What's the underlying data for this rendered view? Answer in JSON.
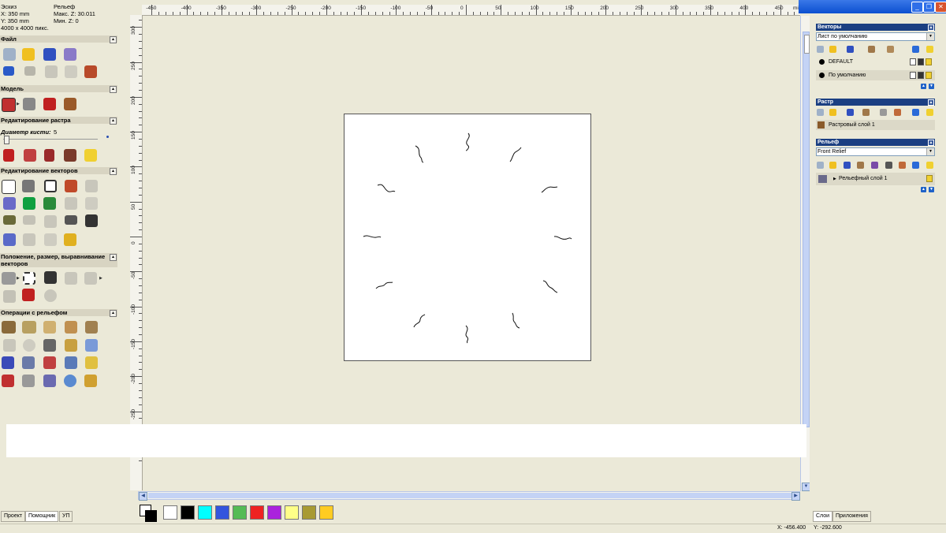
{
  "sketch_info": {
    "sketch_title": "Эскиз",
    "x_size": "X: 350 mm",
    "y_size": "Y: 350 mm",
    "resolution": "4000 x 4000 пикс.",
    "relief_title": "Рельеф",
    "max_z": "Макс. Z: 30.011",
    "min_z": "Мин. Z: 0"
  },
  "left_sections": {
    "file": "Файл",
    "model": "Модель",
    "raster_editing": "Редактирование растра",
    "brush_label": "Диаметр кисти:",
    "brush_value": "5",
    "vector_editing": "Редактирование векторов",
    "position_line1": "Положение, размер, выравнивание",
    "position_line2": "векторов",
    "relief_ops": "Операции с рельефом"
  },
  "left_tabs": [
    "Проект",
    "Помощник",
    "УП"
  ],
  "ruler": {
    "unit": "millimetres",
    "top_labels": [
      "-450",
      "-400",
      "-350",
      "-300",
      "-250",
      "-200",
      "-150",
      "-100",
      "-50",
      "0",
      "50",
      "100",
      "150",
      "200",
      "250",
      "300",
      "350",
      "400",
      "450"
    ],
    "left_labels": [
      "300",
      "250",
      "200",
      "150",
      "100",
      "50",
      "0",
      "-50",
      "-100",
      "-150",
      "-200",
      "-250",
      "-300"
    ]
  },
  "palette_colors": [
    "#ffffff",
    "#000000",
    "#00ffff",
    "#3355dd",
    "#55bb55",
    "#ee2222",
    "#aa22dd",
    "#ffff88",
    "#a89a33",
    "#ffcc22"
  ],
  "status": {
    "x": "X: -456.400",
    "y": "Y: -292.600"
  },
  "right_panel": {
    "vectors_title": "Векторы",
    "vectors_select": "Лист по умолчанию",
    "vector_layers": [
      "DEFAULT",
      "По умолчанию"
    ],
    "raster_title": "Растр",
    "raster_layer": "Растровый слой 1",
    "relief_title": "Рельеф",
    "relief_select": "Front Relief",
    "relief_layer": "Рельефный слой 1",
    "tabs": [
      "Слои",
      "Приложения"
    ]
  },
  "window_buttons": [
    "minimize",
    "restore",
    "close"
  ],
  "colors": {
    "titlebar": "#0b4fd0",
    "panel_header": "#1b3f82",
    "workspace": "#ebe9d8"
  }
}
